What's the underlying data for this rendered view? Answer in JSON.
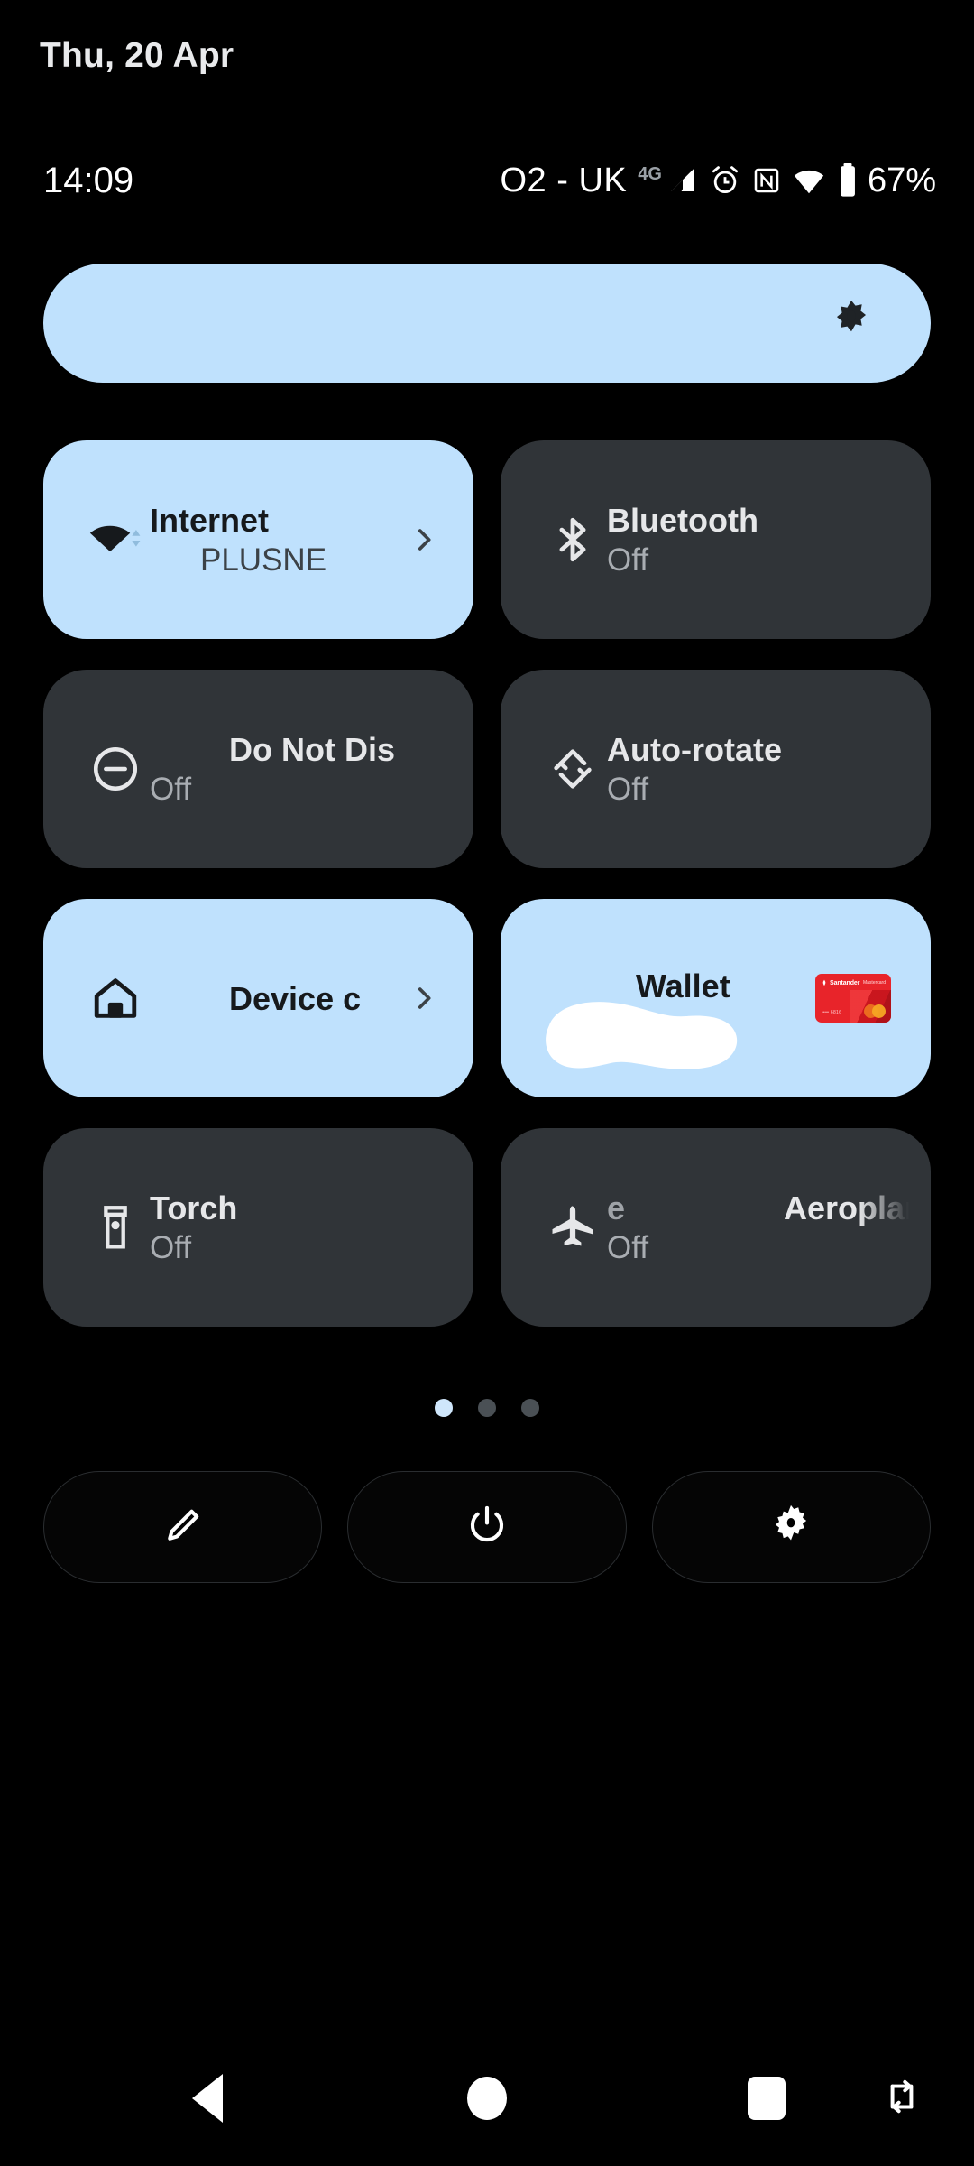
{
  "header": {
    "date": "Thu, 20 Apr"
  },
  "status_bar": {
    "clock": "14:09",
    "carrier": "O2 - UK",
    "network_type": "4G",
    "battery_percent": "67%",
    "icons": [
      {
        "name": "signal-icon",
        "label": "Mobile signal"
      },
      {
        "name": "alarm-icon",
        "label": "Alarm set"
      },
      {
        "name": "nfc-icon",
        "label": "NFC"
      },
      {
        "name": "wifi-icon",
        "label": "Wi-Fi"
      },
      {
        "name": "battery-icon",
        "label": "Battery"
      }
    ]
  },
  "brightness": {
    "name": "brightness-slider",
    "level_percent": 100,
    "icon": "brightness-icon",
    "fill_color": "#bfe1fd"
  },
  "tiles": [
    {
      "id": "internet",
      "title": "Internet",
      "subtitle": "PLUSNE",
      "state": "on",
      "icon": "wifi-icon",
      "has_chevron": true,
      "title_clipped": false,
      "subtitle_clipped": true
    },
    {
      "id": "bluetooth",
      "title": "Bluetooth",
      "subtitle": "Off",
      "state": "off",
      "icon": "bluetooth-icon",
      "has_chevron": false
    },
    {
      "id": "do-not-disturb",
      "title": "Do Not Dis",
      "subtitle": "Off",
      "state": "off",
      "icon": "do-not-disturb-icon",
      "has_chevron": false,
      "title_clipped": true
    },
    {
      "id": "auto-rotate",
      "title": "Auto-rotate",
      "subtitle": "Off",
      "state": "off",
      "icon": "auto-rotate-icon",
      "has_chevron": false
    },
    {
      "id": "device-controls",
      "title": "Device c",
      "subtitle": "",
      "state": "on",
      "icon": "home-icon",
      "has_chevron": true,
      "title_clipped": true
    },
    {
      "id": "wallet",
      "title": "Wallet",
      "subtitle": "",
      "state": "on",
      "icon": "",
      "has_chevron": false,
      "redacted": true,
      "card": {
        "bank": "Santander",
        "brand": "Mastercard",
        "masked_number": "•••• 6816",
        "color": "#e8242a"
      }
    },
    {
      "id": "torch",
      "title": "Torch",
      "subtitle": "Off",
      "state": "off",
      "icon": "torch-icon",
      "has_chevron": false
    },
    {
      "id": "aeroplane-mode",
      "title": "Aeroplan",
      "title_prefix": "e",
      "subtitle": "Off",
      "state": "off",
      "icon": "aeroplane-icon",
      "has_chevron": false,
      "title_clipped": true
    }
  ],
  "pager": {
    "total_pages": 3,
    "active_page": 1
  },
  "footer_buttons": [
    {
      "id": "edit",
      "icon": "pencil-icon",
      "label": "Edit"
    },
    {
      "id": "power",
      "icon": "power-icon",
      "label": "Power"
    },
    {
      "id": "settings",
      "icon": "gear-icon",
      "label": "Settings"
    }
  ],
  "nav_bar": [
    {
      "id": "back",
      "icon": "back-triangle-icon",
      "label": "Back"
    },
    {
      "id": "home",
      "icon": "home-circle-icon",
      "label": "Home"
    },
    {
      "id": "recents",
      "icon": "recents-square-icon",
      "label": "Recents"
    },
    {
      "id": "rotate",
      "icon": "screen-rotate-icon",
      "label": "Rotate screen"
    }
  ],
  "colors": {
    "background": "#000000",
    "tile_on": "#bfe1fd",
    "tile_off": "#303438",
    "text_on": "#16191c",
    "text_off": "#e6e7e9"
  }
}
